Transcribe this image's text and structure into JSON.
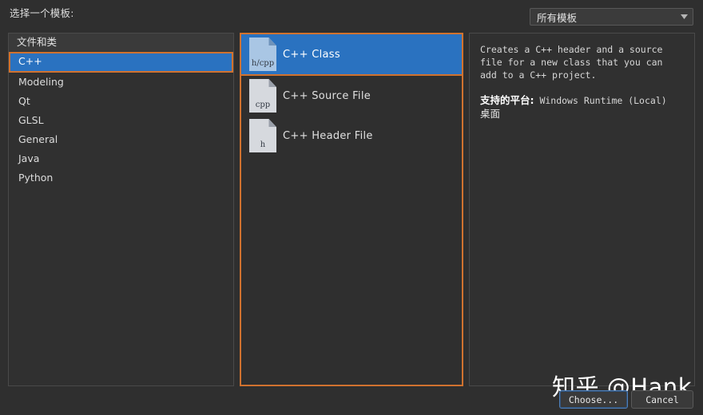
{
  "dialog": {
    "title": "选择一个模板:"
  },
  "filter": {
    "selected": "所有模板",
    "icon": "chevron-down-icon"
  },
  "categories": {
    "header": "文件和类",
    "items": [
      {
        "label": "C++",
        "selected": true
      },
      {
        "label": "Modeling",
        "selected": false
      },
      {
        "label": "Qt",
        "selected": false
      },
      {
        "label": "GLSL",
        "selected": false
      },
      {
        "label": "General",
        "selected": false
      },
      {
        "label": "Java",
        "selected": false
      },
      {
        "label": "Python",
        "selected": false
      }
    ]
  },
  "templates": {
    "items": [
      {
        "label": "C++ Class",
        "ext": "h/cpp",
        "icon": "file-icon",
        "selected": true
      },
      {
        "label": "C++ Source File",
        "ext": "cpp",
        "icon": "file-icon",
        "selected": false
      },
      {
        "label": "C++ Header File",
        "ext": "h",
        "icon": "file-icon",
        "selected": false
      }
    ]
  },
  "description": {
    "text": "Creates a C++ header and a source file for a new class that you can add to a C++ project.",
    "platforms_label": "支持的平台:",
    "platforms_value": "Windows Runtime (Local)",
    "platforms_extra": "桌面"
  },
  "buttons": {
    "choose": "Choose...",
    "cancel": "Cancel"
  },
  "watermark": "知乎 @Hank",
  "colors": {
    "selection_blue": "#2a72c0",
    "focus_orange": "#d0722f",
    "panel_bg": "#303030",
    "window_bg": "#2f2f2f",
    "choose_border": "#4f7fb8"
  }
}
